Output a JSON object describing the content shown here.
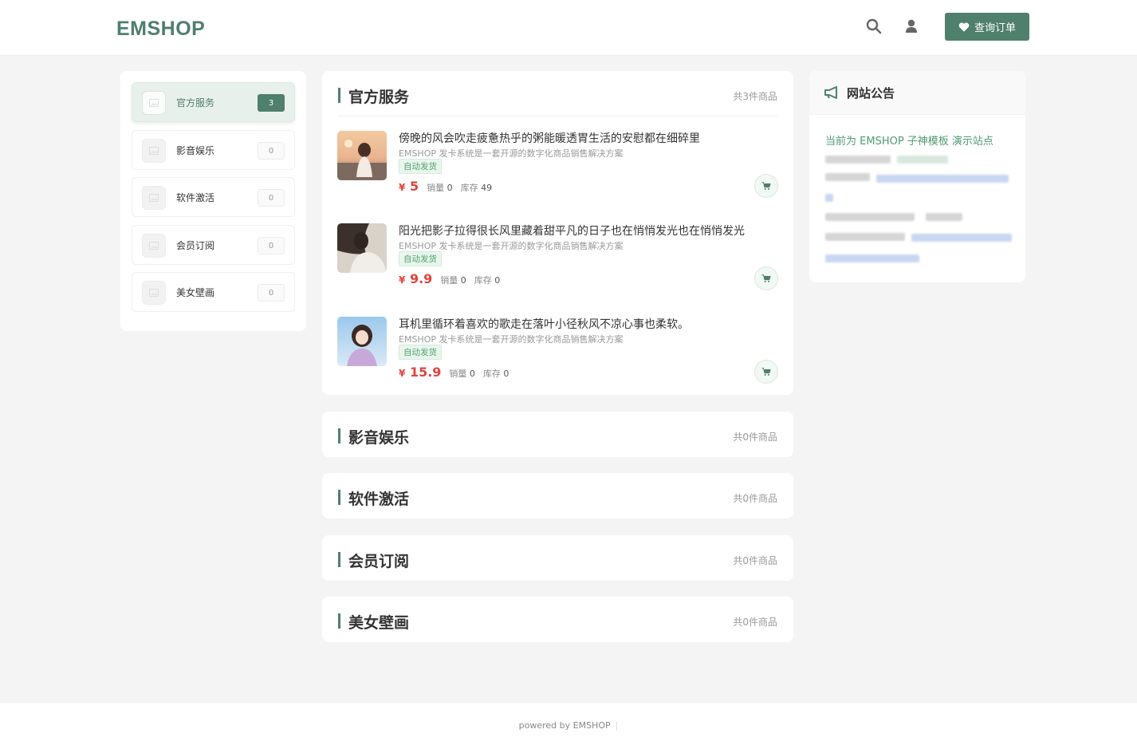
{
  "brand": {
    "logo": "EMSHOP",
    "accent": "#4f7f6d",
    "price_color": "#e0443c"
  },
  "header": {
    "order_button_label": "查询订单"
  },
  "sidebar": {
    "items": [
      {
        "label": "官方服务",
        "count": "3",
        "active": true
      },
      {
        "label": "影音娱乐",
        "count": "0"
      },
      {
        "label": "软件激活",
        "count": "0"
      },
      {
        "label": "会员订阅",
        "count": "0"
      },
      {
        "label": "美女壁画",
        "count": "0"
      }
    ]
  },
  "categories": [
    {
      "title": "官方服务",
      "count_text": "共3件商品",
      "products": [
        {
          "name": "傍晚的风会吹走疲惫热乎的粥能暖透胃生活的安慰都在细碎里",
          "desc": "EMSHOP 发卡系统是一套开源的数字化商品销售解决方案",
          "tag": "自动发货",
          "price_symbol": "¥",
          "price": "5",
          "sales_label": "销量",
          "sales": "0",
          "stock_label": "库存",
          "stock": "49"
        },
        {
          "name": "阳光把影子拉得很长风里藏着甜平凡的日子也在悄悄发光也在悄悄发光",
          "desc": "EMSHOP 发卡系统是一套开源的数字化商品销售解决方案",
          "tag": "自动发货",
          "price_symbol": "¥",
          "price": "9.9",
          "sales_label": "销量",
          "sales": "0",
          "stock_label": "库存",
          "stock": "0"
        },
        {
          "name": "耳机里循环着喜欢的歌走在落叶小径秋风不凉心事也柔软。",
          "desc": "EMSHOP 发卡系统是一套开源的数字化商品销售解决方案",
          "tag": "自动发货",
          "price_symbol": "¥",
          "price": "15.9",
          "sales_label": "销量",
          "sales": "0",
          "stock_label": "库存",
          "stock": "0"
        }
      ]
    },
    {
      "title": "影音娱乐",
      "count_text": "共0件商品"
    },
    {
      "title": "软件激活",
      "count_text": "共0件商品"
    },
    {
      "title": "会员订阅",
      "count_text": "共0件商品"
    },
    {
      "title": "美女壁画",
      "count_text": "共0件商品"
    }
  ],
  "notice": {
    "title": "网站公告",
    "text": "当前为 EMSHOP 子神模板 演示站点"
  },
  "footer": {
    "text": "powered by EMSHOP",
    "divider": "|"
  }
}
